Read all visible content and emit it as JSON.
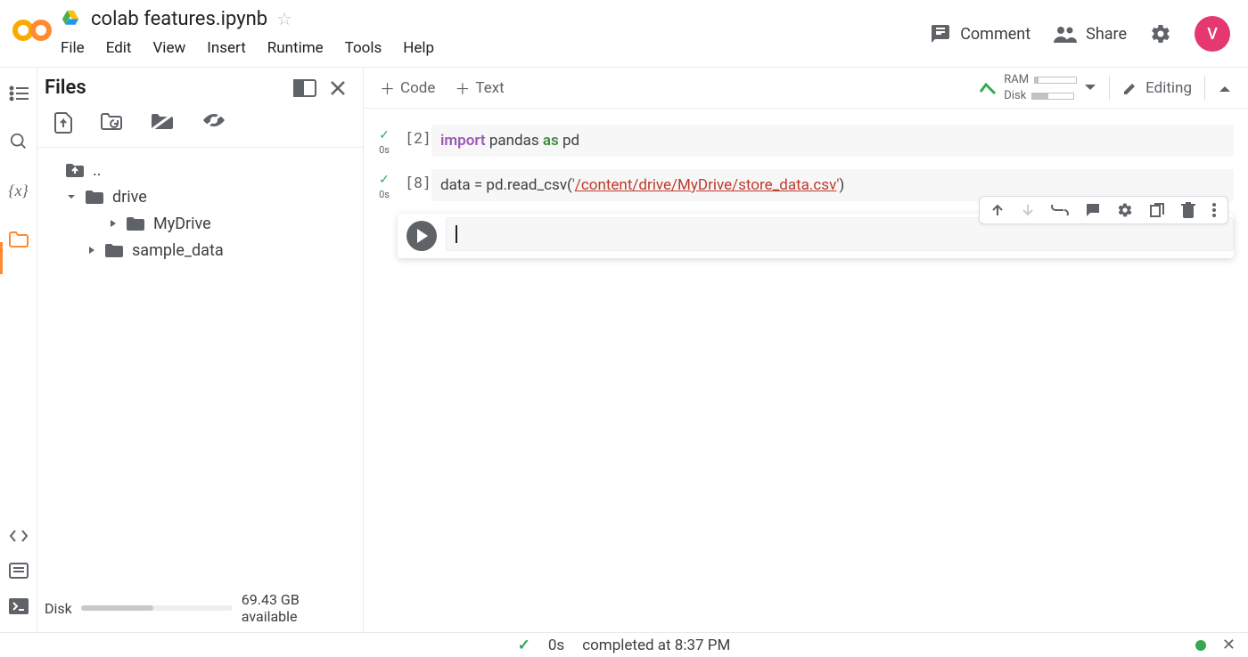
{
  "header": {
    "title": "colab features.ipynb",
    "menus": [
      "File",
      "Edit",
      "View",
      "Insert",
      "Runtime",
      "Tools",
      "Help"
    ],
    "comment": "Comment",
    "share": "Share",
    "avatar": "V"
  },
  "sidebar": {
    "title": "Files",
    "items": [
      {
        "label": "..",
        "kind": "up"
      },
      {
        "label": "drive",
        "kind": "folder",
        "expanded": true
      },
      {
        "label": "MyDrive",
        "kind": "folder",
        "expanded": false,
        "level": 3
      },
      {
        "label": "sample_data",
        "kind": "folder",
        "expanded": false,
        "level": 2
      }
    ],
    "disk_label": "Disk",
    "disk_text": "69.43 GB available"
  },
  "toolbar": {
    "code": "Code",
    "text": "Text",
    "ram": "RAM",
    "disk": "Disk",
    "editing": "Editing"
  },
  "cells": [
    {
      "exec": "2",
      "time": "0s",
      "tokens": [
        {
          "t": "import ",
          "c": "kw"
        },
        {
          "t": "pandas ",
          "c": ""
        },
        {
          "t": "as ",
          "c": "as"
        },
        {
          "t": "pd",
          "c": ""
        }
      ]
    },
    {
      "exec": "8",
      "time": "0s",
      "tokens": [
        {
          "t": "data = pd.read_csv(",
          "c": ""
        },
        {
          "t": "'",
          "c": "str-plain"
        },
        {
          "t": "/content/drive/MyDrive/store_data.csv",
          "c": "str"
        },
        {
          "t": "'",
          "c": "str-plain"
        },
        {
          "t": ")",
          "c": ""
        }
      ]
    }
  ],
  "status": {
    "time": "0s",
    "text": "completed at 8:37 PM"
  }
}
